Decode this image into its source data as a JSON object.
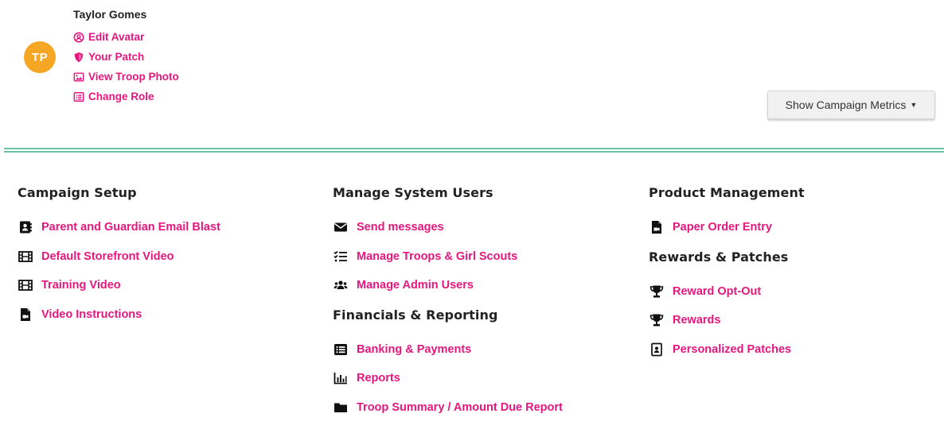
{
  "profile": {
    "initials": "TP",
    "avatar_color": "#f5a623",
    "name": "Taylor Gomes",
    "links": [
      {
        "label": "Edit Avatar",
        "icon": "user-circle-icon"
      },
      {
        "label": "Your Patch",
        "icon": "shield-icon"
      },
      {
        "label": "View Troop Photo",
        "icon": "image-icon"
      },
      {
        "label": "Change Role",
        "icon": "list-alt-icon"
      }
    ]
  },
  "metrics_button": {
    "label": "Show Campaign Metrics"
  },
  "colors": {
    "link": "#e5177e",
    "divider": "#6cc3a3",
    "heading": "#222222"
  },
  "sections": {
    "campaign_setup": {
      "title": "Campaign Setup",
      "links": [
        {
          "label": "Parent and Guardian Email Blast",
          "icon": "address-book-icon"
        },
        {
          "label": "Default Storefront Video",
          "icon": "film-icon"
        },
        {
          "label": "Training Video",
          "icon": "film-icon"
        },
        {
          "label": "Video Instructions",
          "icon": "file-video-icon"
        }
      ]
    },
    "manage_system_users": {
      "title": "Manage System Users",
      "links": [
        {
          "label": "Send messages",
          "icon": "envelope-icon"
        },
        {
          "label": "Manage Troops & Girl Scouts",
          "icon": "list-check-icon"
        },
        {
          "label": "Manage Admin Users",
          "icon": "users-icon"
        }
      ]
    },
    "financials_reporting": {
      "title": "Financials & Reporting",
      "links": [
        {
          "label": "Banking & Payments",
          "icon": "list-icon"
        },
        {
          "label": "Reports",
          "icon": "bar-chart-icon"
        },
        {
          "label": "Troop Summary / Amount Due Report",
          "icon": "folder-icon"
        }
      ]
    },
    "product_management": {
      "title": "Product Management",
      "links": [
        {
          "label": "Paper Order Entry",
          "icon": "file-video-icon"
        }
      ]
    },
    "rewards_patches": {
      "title": "Rewards & Patches",
      "links": [
        {
          "label": "Reward Opt-Out",
          "icon": "trophy-icon"
        },
        {
          "label": "Rewards",
          "icon": "trophy-icon"
        },
        {
          "label": "Personalized Patches",
          "icon": "id-badge-icon"
        }
      ]
    }
  }
}
